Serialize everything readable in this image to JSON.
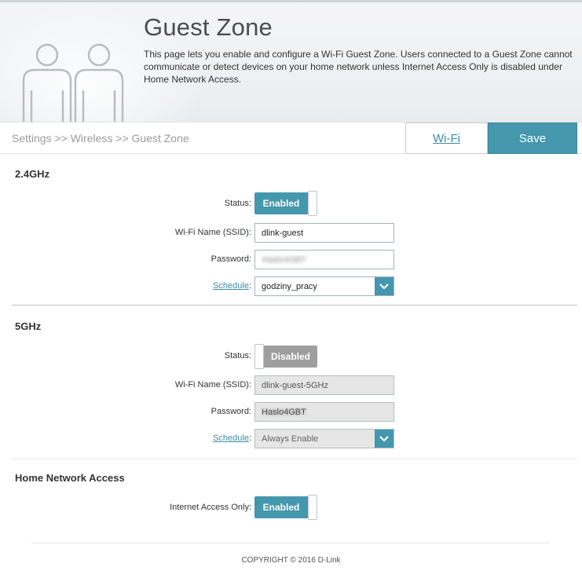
{
  "header": {
    "title": "Guest Zone",
    "description": "This page lets you enable and configure a Wi-Fi Guest Zone. Users connected to a Guest Zone cannot communicate or detect devices on your home network unless Internet Access Only is disabled under Home Network Access.",
    "icon": "two-people-icon"
  },
  "nav": {
    "breadcrumb": "Settings >> Wireless >> Guest Zone",
    "wifi_link": "Wi-Fi",
    "save_label": "Save"
  },
  "band_24": {
    "title": "2.4GHz",
    "status_label": "Status:",
    "status_value": "Enabled",
    "ssid_label": "Wi-Fi Name (SSID):",
    "ssid_value": "dlink-guest",
    "password_label": "Password:",
    "password_value": "Haslo4GBT",
    "schedule_link": "Schedule",
    "schedule_colon": ":",
    "schedule_value": "godziny_pracy"
  },
  "band_5": {
    "title": "5GHz",
    "status_label": "Status:",
    "status_value": "Disabled",
    "ssid_label": "Wi-Fi Name (SSID):",
    "ssid_value": "dlink-guest-5GHz",
    "password_label": "Password:",
    "password_value": "Haslo4GBT",
    "schedule_link": "Schedule",
    "schedule_colon": ":",
    "schedule_value": "Always Enable"
  },
  "home_access": {
    "title": "Home Network Access",
    "internet_only_label": "Internet Access Only:",
    "internet_only_value": "Enabled"
  },
  "footer": {
    "copyright": "COPYRIGHT © 2016 D-Link"
  },
  "colors": {
    "accent": "#4497ad",
    "link": "#3d8da6",
    "disabled_toggle": "#9e9e9e"
  }
}
